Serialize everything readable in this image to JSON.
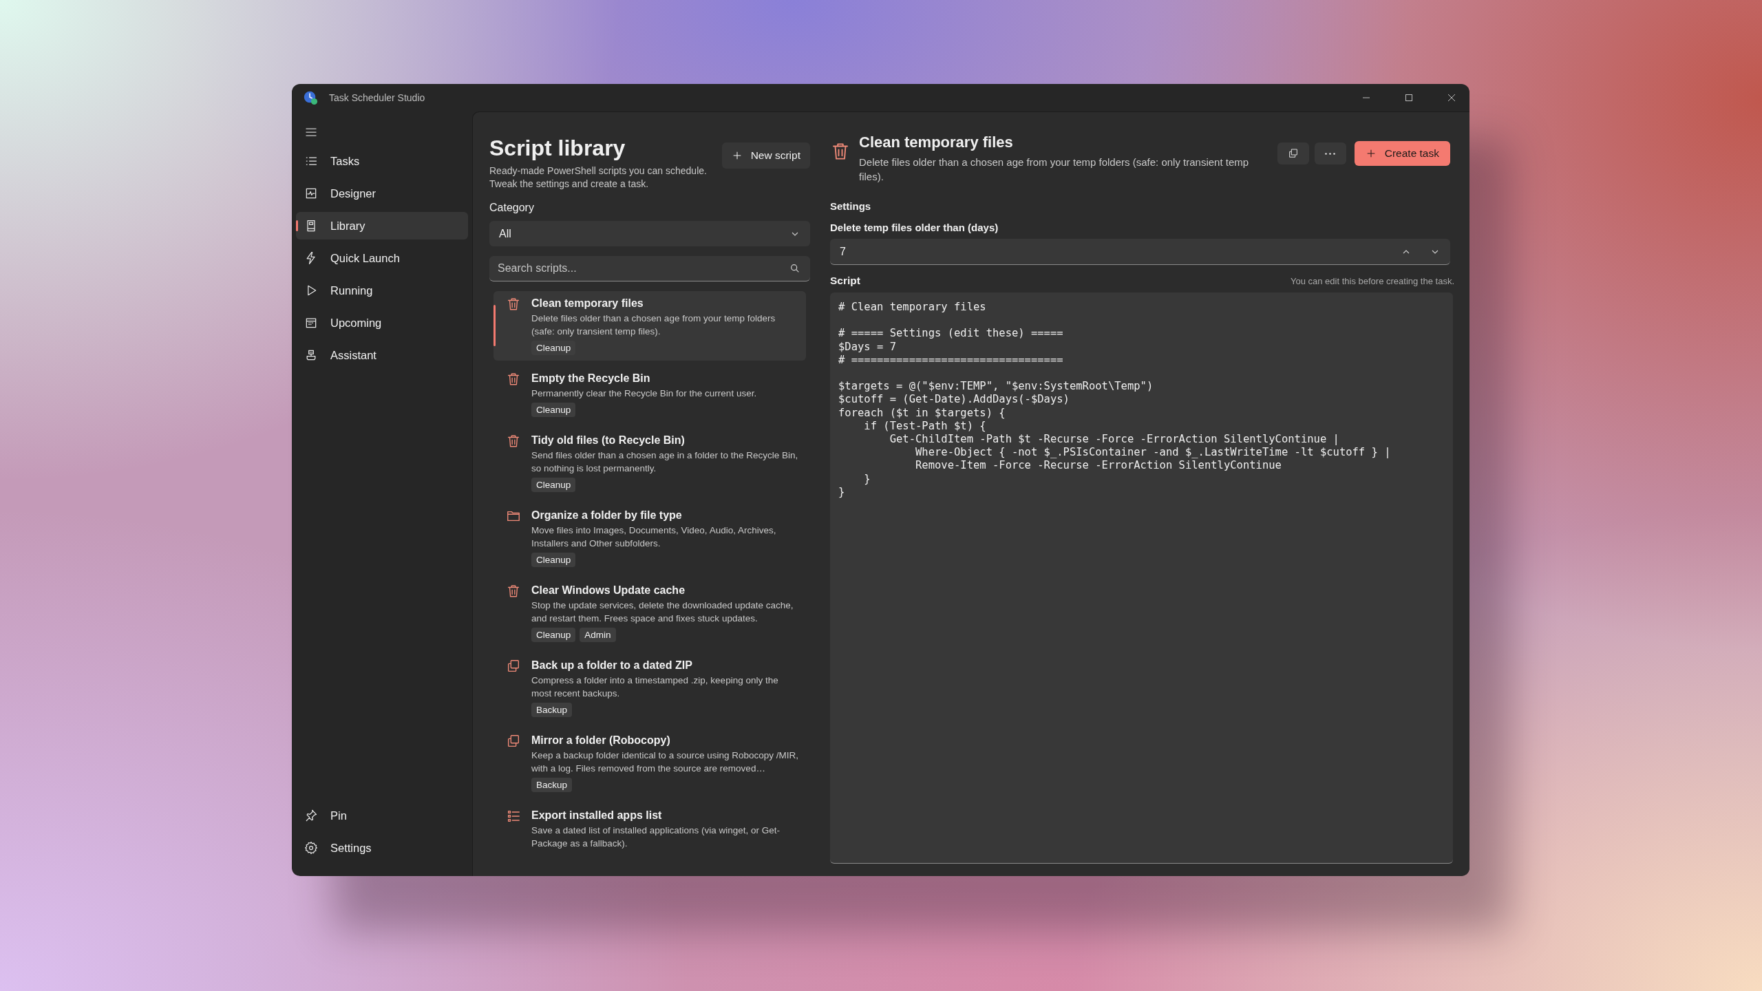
{
  "window": {
    "title": "Task Scheduler Studio"
  },
  "sidebar": {
    "items": [
      {
        "label": "Tasks",
        "kind": "list",
        "selected": false
      },
      {
        "label": "Designer",
        "kind": "pulse",
        "selected": false
      },
      {
        "label": "Library",
        "kind": "book",
        "selected": true
      },
      {
        "label": "Quick Launch",
        "kind": "bolt",
        "selected": false
      },
      {
        "label": "Running",
        "kind": "play",
        "selected": false
      },
      {
        "label": "Upcoming",
        "kind": "calendar",
        "selected": false
      },
      {
        "label": "Assistant",
        "kind": "bot",
        "selected": false
      }
    ],
    "footer_items": [
      {
        "label": "Pin",
        "kind": "pin"
      },
      {
        "label": "Settings",
        "kind": "gear"
      }
    ]
  },
  "library": {
    "title": "Script library",
    "subtitle": "Ready-made PowerShell scripts you can schedule. Tweak the settings and create a task.",
    "new_button": "New script",
    "category": {
      "label": "Category",
      "value": "All"
    },
    "search": {
      "placeholder": "Search scripts..."
    },
    "scripts": [
      {
        "title": "Clean temporary files",
        "description": "Delete files older than a chosen age from your temp folders (safe: only transient temp files).",
        "tags": [
          "Cleanup"
        ],
        "kind": "trash",
        "selected": true
      },
      {
        "title": "Empty the Recycle Bin",
        "description": "Permanently clear the Recycle Bin for the current user.",
        "tags": [
          "Cleanup"
        ],
        "kind": "trash",
        "selected": false
      },
      {
        "title": "Tidy old files (to Recycle Bin)",
        "description": "Send files older than a chosen age in a folder to the Recycle Bin, so nothing is lost permanently.",
        "tags": [
          "Cleanup"
        ],
        "kind": "trash",
        "selected": false
      },
      {
        "title": "Organize a folder by file type",
        "description": "Move files into Images, Documents, Video, Audio, Archives, Installers and Other subfolders.",
        "tags": [
          "Cleanup"
        ],
        "kind": "folder",
        "selected": false
      },
      {
        "title": "Clear Windows Update cache",
        "description": "Stop the update services, delete the downloaded update cache, and restart them. Frees space and fixes stuck updates.",
        "tags": [
          "Cleanup",
          "Admin"
        ],
        "kind": "trash",
        "selected": false
      },
      {
        "title": "Back up a folder to a dated ZIP",
        "description": "Compress a folder into a timestamped .zip, keeping only the most recent backups.",
        "tags": [
          "Backup"
        ],
        "kind": "copy",
        "selected": false
      },
      {
        "title": "Mirror a folder (Robocopy)",
        "description": "Keep a backup folder identical to a source using Robocopy /MIR, with a log. Files removed from the source are removed…",
        "tags": [
          "Backup"
        ],
        "kind": "copy",
        "selected": false
      },
      {
        "title": "Export installed apps list",
        "description": "Save a dated list of installed applications (via winget, or Get-Package as a fallback).",
        "kind": "listbox",
        "selected": false
      }
    ]
  },
  "detail": {
    "title": "Clean temporary files",
    "description": "Delete files older than a chosen age from your temp folders (safe: only transient temp files).",
    "create_button": "Create task",
    "settings_heading": "Settings",
    "setting": {
      "label": "Delete temp files older than (days)",
      "value": "7"
    },
    "script": {
      "label": "Script",
      "note": "You can edit this before creating the task.",
      "code": "# Clean temporary files\n\n# ===== Settings (edit these) =====\n$Days = 7\n# =================================\n\n$targets = @(\"$env:TEMP\", \"$env:SystemRoot\\Temp\")\n$cutoff = (Get-Date).AddDays(-$Days)\nforeach ($t in $targets) {\n    if (Test-Path $t) {\n        Get-ChildItem -Path $t -Recurse -Force -ErrorAction SilentlyContinue |\n            Where-Object { -not $_.PSIsContainer -and $_.LastWriteTime -lt $cutoff } |\n            Remove-Item -Force -Recurse -ErrorAction SilentlyContinue\n    }\n}"
    }
  }
}
